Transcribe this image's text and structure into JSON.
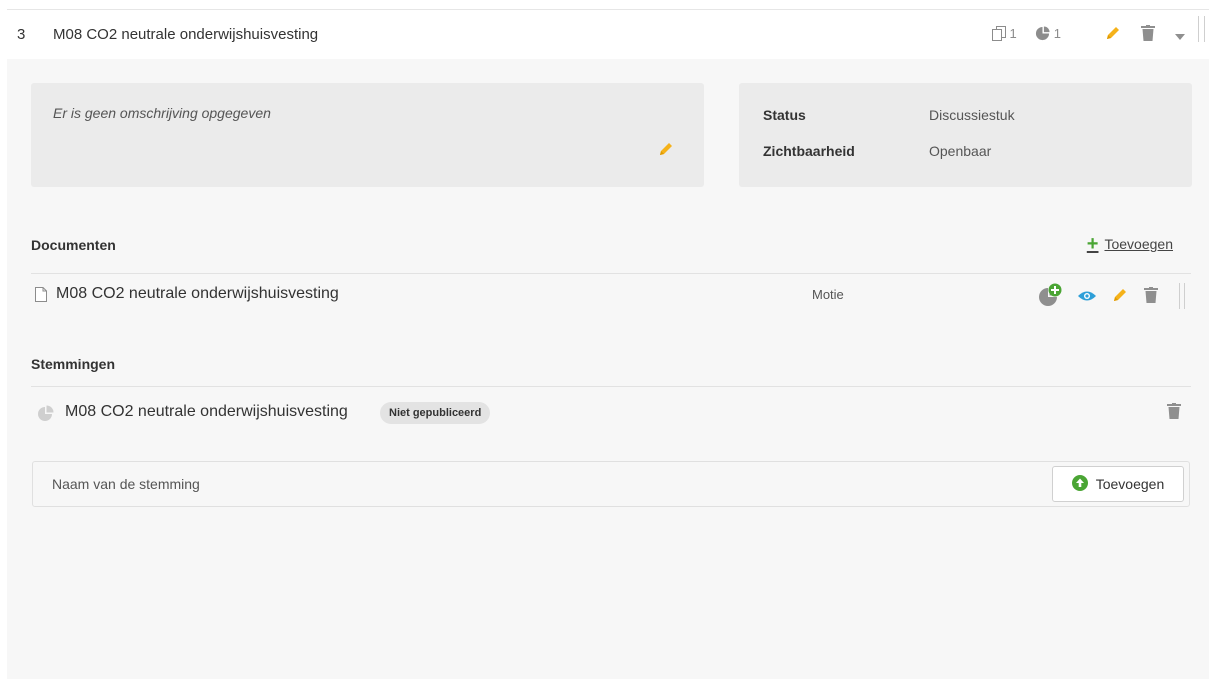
{
  "item": {
    "number": "3",
    "title": "M08 CO2 neutrale onderwijshuisvesting",
    "document_count": "1",
    "vote_count": "1"
  },
  "description": {
    "text": "Er is geen omschrijving opgegeven"
  },
  "info": {
    "status_label": "Status",
    "status_value": "Discussiestuk",
    "visibility_label": "Zichtbaarheid",
    "visibility_value": "Openbaar"
  },
  "documents": {
    "title": "Documenten",
    "add_label": "Toevoegen",
    "items": [
      {
        "name": "M08 CO2 neutrale onderwijshuisvesting",
        "type": "Motie"
      }
    ]
  },
  "votes": {
    "title": "Stemmingen",
    "items": [
      {
        "name": "M08 CO2 neutrale onderwijshuisvesting",
        "badge": "Niet gepubliceerd"
      }
    ],
    "input_placeholder": "Naam van de stemming",
    "add_label": "Toevoegen"
  },
  "colors": {
    "edit": "#f5b21a",
    "delete": "#8f8f8f",
    "view": "#2e9fd8",
    "add_green": "#4aa534"
  },
  "icons": [
    "documents-icon",
    "pie-chart-icon",
    "pencil-icon",
    "trash-icon",
    "caret-down-icon",
    "file-icon",
    "eye-icon",
    "plus-icon",
    "arrow-up-circle-icon"
  ]
}
